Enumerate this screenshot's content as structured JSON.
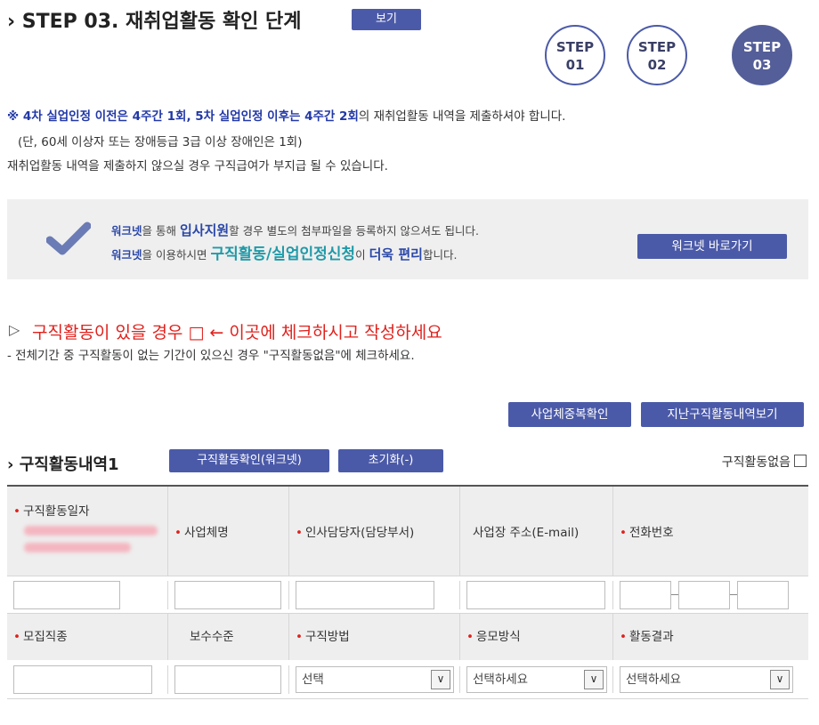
{
  "header": {
    "title": "STEP 03. 재취업활동 확인 단계",
    "view_button": "보기",
    "steps": [
      {
        "line1": "STEP",
        "line2": "01"
      },
      {
        "line1": "STEP",
        "line2": "02"
      },
      {
        "line1": "STEP",
        "line2": "03"
      }
    ]
  },
  "notices": {
    "mark": "※ ",
    "part1_blue": "4차 실업인정 이전은 4주간 1회",
    "part2_blue": ", 5차 실업인정 이후는 4주간 2회",
    "part3": "의 재취업활동 내역을 제출하셔야 합니다.",
    "line2": "(단, 60세 이상자 또는 장애등급 3급 이상 장애인은 1회)",
    "line3": "재취업활동 내역을 제출하지 않으실 경우 구직급여가 부지급 될 수 있습니다."
  },
  "worknet": {
    "l1_a": "워크넷",
    "l1_b": "을 통해 ",
    "l1_c": "입사지원",
    "l1_d": "할 경우 별도의 첨부파일을 등록하지 않으셔도 됩니다.",
    "l2_a": "워크넷",
    "l2_b": "을 이용하시면 ",
    "l2_c": "구직활동/실업인정신청",
    "l2_d": "이 ",
    "l2_e": "더욱 편리",
    "l2_f": "합니다.",
    "button": "워크넷 바로가기"
  },
  "instruction": {
    "triangle": "▷",
    "title": "구직활동이 있을 경우 □ ← 이곳에 체크하시고 작성하세요",
    "sub": "- 전체기간 중 구직활동이 없는 기간이 있으신 경우 \"구직활동없음\"에 체크하세요."
  },
  "actions": {
    "business_dup": "사업체중복확인",
    "past_history": "지난구직활동내역보기"
  },
  "section": {
    "title": "구직활동내역1",
    "confirm_btn": "구직활동확인(워크넷)",
    "reset_btn": "초기화(-)",
    "none_label": "구직활동없음"
  },
  "table": {
    "row1_headers": [
      "구직활동일자",
      "사업체명",
      "인사담당자(담당부서)",
      "사업장 주소(E-mail)",
      "전화번호"
    ],
    "row2_headers": [
      "모집직종",
      "보수수준",
      "구직방법",
      "응모방식",
      "활동결과"
    ],
    "select_values": [
      "선택",
      "선택하세요",
      "선택하세요"
    ]
  },
  "colors": {
    "accent": "#4b5aa8",
    "red": "#e0211c",
    "blue_text": "#2238a8"
  }
}
